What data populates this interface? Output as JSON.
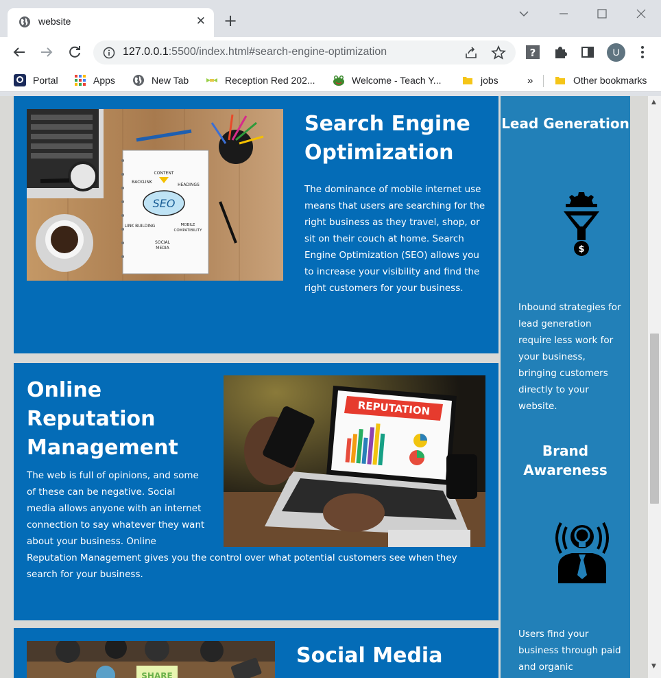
{
  "browser": {
    "tab_title": "website",
    "url_host": "127.0.0.1",
    "url_rest": ":5500/index.html#search-engine-optimization",
    "avatar_letter": "U",
    "bookmarks": [
      {
        "label": "Portal",
        "icon": "portal-icon"
      },
      {
        "label": "Apps",
        "icon": "apps-grid-icon"
      },
      {
        "label": "New Tab",
        "icon": "globe-icon"
      },
      {
        "label": "Reception Red 202...",
        "icon": "reception-icon"
      },
      {
        "label": "Welcome - Teach Y...",
        "icon": "frog-icon"
      },
      {
        "label": "jobs",
        "icon": "folder-icon"
      }
    ],
    "overflow": "»",
    "other_bookmarks": "Other bookmarks"
  },
  "page": {
    "seo": {
      "title": "Search Engine Optimization",
      "body": "The dominance of mobile internet use means that users are searching for the right business as they travel, shop, or sit on their couch at home. Search Engine Optimization (SEO) allows you to increase your visibility and find the right customers for your business.",
      "image_words": [
        "CONTENT",
        "BACKLINK",
        "HEADINGS",
        "SEO",
        "LINK BUILDING",
        "MOBILE COMPATIBILITY",
        "SOCIAL MEDIA"
      ]
    },
    "orm": {
      "title": "Online Reputation Management",
      "body": "The web is full of opinions, and some of these can be negative. Social media allows anyone with an internet connection to say whatever they want about your business. Online Reputation Management gives you the control over what potential customers see when they search for your business.",
      "image_word": "REPUTATION"
    },
    "social": {
      "title": "Social Media",
      "image_word": "SHARE"
    },
    "sidebar": {
      "lead_title": "Lead Generation",
      "lead_body": "Inbound strategies for lead generation require less work for your business, bringing customers directly to your website.",
      "brand_title": "Brand Awareness",
      "brand_body": "Users find your business through paid and organic"
    }
  },
  "colors": {
    "card_blue": "#046cb7",
    "sidebar_blue": "#2280b8",
    "page_gray": "#d9d9d6"
  }
}
